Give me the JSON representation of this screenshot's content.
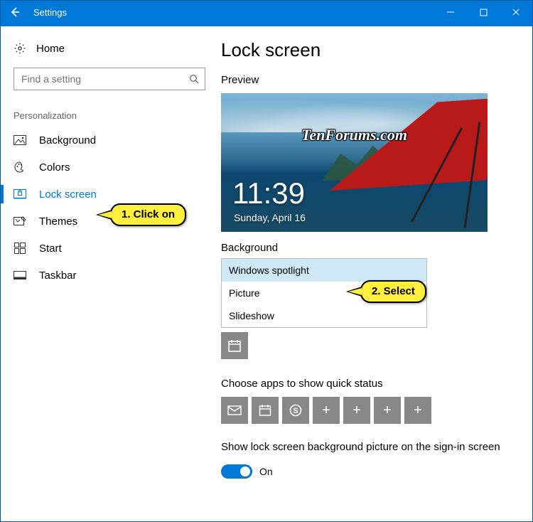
{
  "titlebar": {
    "title": "Settings"
  },
  "sidebar": {
    "home": "Home",
    "search_placeholder": "Find a setting",
    "section": "Personalization",
    "items": [
      {
        "label": "Background"
      },
      {
        "label": "Colors"
      },
      {
        "label": "Lock screen"
      },
      {
        "label": "Themes"
      },
      {
        "label": "Start"
      },
      {
        "label": "Taskbar"
      }
    ]
  },
  "main": {
    "title": "Lock screen",
    "preview_label": "Preview",
    "preview": {
      "watermark": "TenForums.com",
      "time": "11:39",
      "date": "Sunday, April 16"
    },
    "background_label": "Background",
    "background_options": [
      "Windows spotlight",
      "Picture",
      "Slideshow"
    ],
    "quick_status_label": "Choose apps to show quick status",
    "signin_label": "Show lock screen background picture on the sign-in screen",
    "toggle_state": "On"
  },
  "annotations": {
    "step1": "1. Click on",
    "step2": "2. Select"
  }
}
